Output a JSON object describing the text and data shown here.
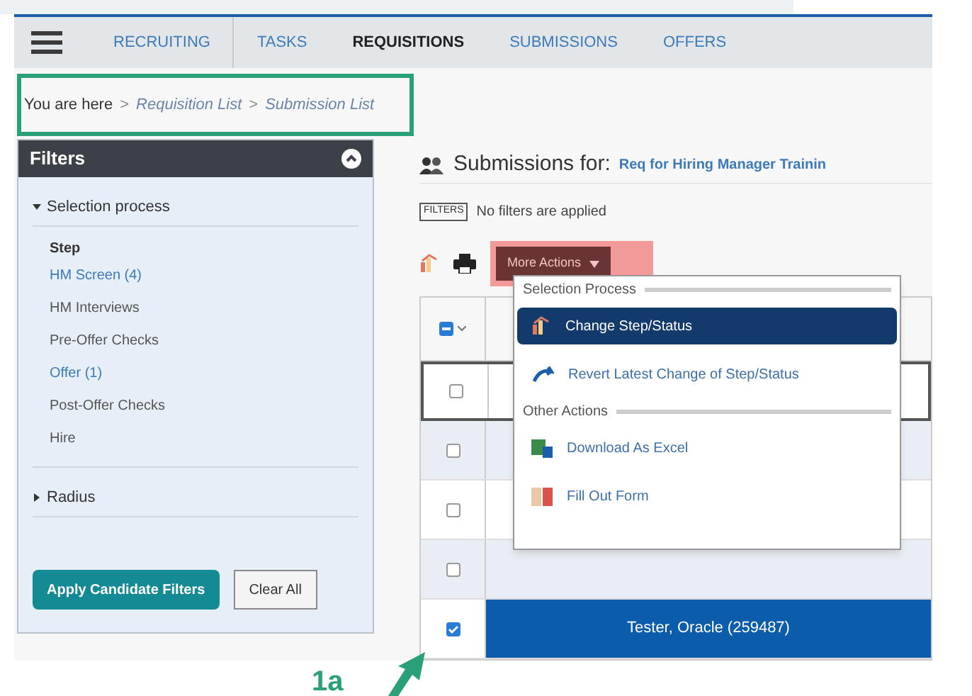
{
  "nav": {
    "items": [
      {
        "label": "RECRUITING",
        "selected": false
      },
      {
        "label": "TASKS",
        "selected": false
      },
      {
        "label": "REQUISITIONS",
        "selected": true
      },
      {
        "label": "SUBMISSIONS",
        "selected": false
      },
      {
        "label": "OFFERS",
        "selected": false
      }
    ]
  },
  "breadcrumb": [
    {
      "kind": "label",
      "text": "You are here"
    },
    {
      "kind": "sep",
      "text": ">"
    },
    {
      "kind": "link",
      "text": "Requisition List"
    },
    {
      "kind": "sep",
      "text": ">"
    },
    {
      "kind": "link",
      "text": "Submission List"
    }
  ],
  "filters": {
    "title": "Filters",
    "expanded": true,
    "sections": [
      {
        "label": "Selection process",
        "expanded": true,
        "heading": "Step",
        "options": [
          {
            "label": "HM Screen (4)",
            "has_results": true
          },
          {
            "label": "HM Interviews",
            "has_results": false
          },
          {
            "label": "Pre-Offer Checks",
            "has_results": false
          },
          {
            "label": "Offer (1)",
            "has_results": true
          },
          {
            "label": "Post-Offer Checks",
            "has_results": false
          },
          {
            "label": "Hire",
            "has_results": false
          }
        ]
      },
      {
        "label": "Radius",
        "expanded": false
      }
    ],
    "buttons": [
      "Apply Candidate Filters",
      "Clear All"
    ]
  },
  "main": {
    "title": "Submissions for:",
    "requisition": "Req for Hiring Manager Trainin",
    "filter_tag": "FILTERS",
    "filter_status": "No filters are applied",
    "more_actions": "More Actions"
  },
  "menu": [
    {
      "kind": "header",
      "text": "Selection Process"
    },
    {
      "kind": "item",
      "text": "Change Step/Status",
      "selected": true
    },
    {
      "kind": "item",
      "text": "Revert Latest Change of Step/Status",
      "selected": false
    },
    {
      "kind": "header",
      "text": "Other Actions"
    },
    {
      "kind": "item",
      "text": "Download As Excel",
      "selected": false
    },
    {
      "kind": "item",
      "text": "Fill Out Form",
      "selected": false
    }
  ],
  "table": {
    "some_checked": true,
    "rows": [
      {
        "checked": false,
        "selected": false
      },
      {
        "checked": false,
        "selected": false
      },
      {
        "checked": false,
        "selected": false
      },
      {
        "checked": false,
        "selected": false
      },
      {
        "checked": true,
        "selected": true,
        "name": "Tester, Oracle (259487)"
      }
    ]
  },
  "annotation": "1a"
}
